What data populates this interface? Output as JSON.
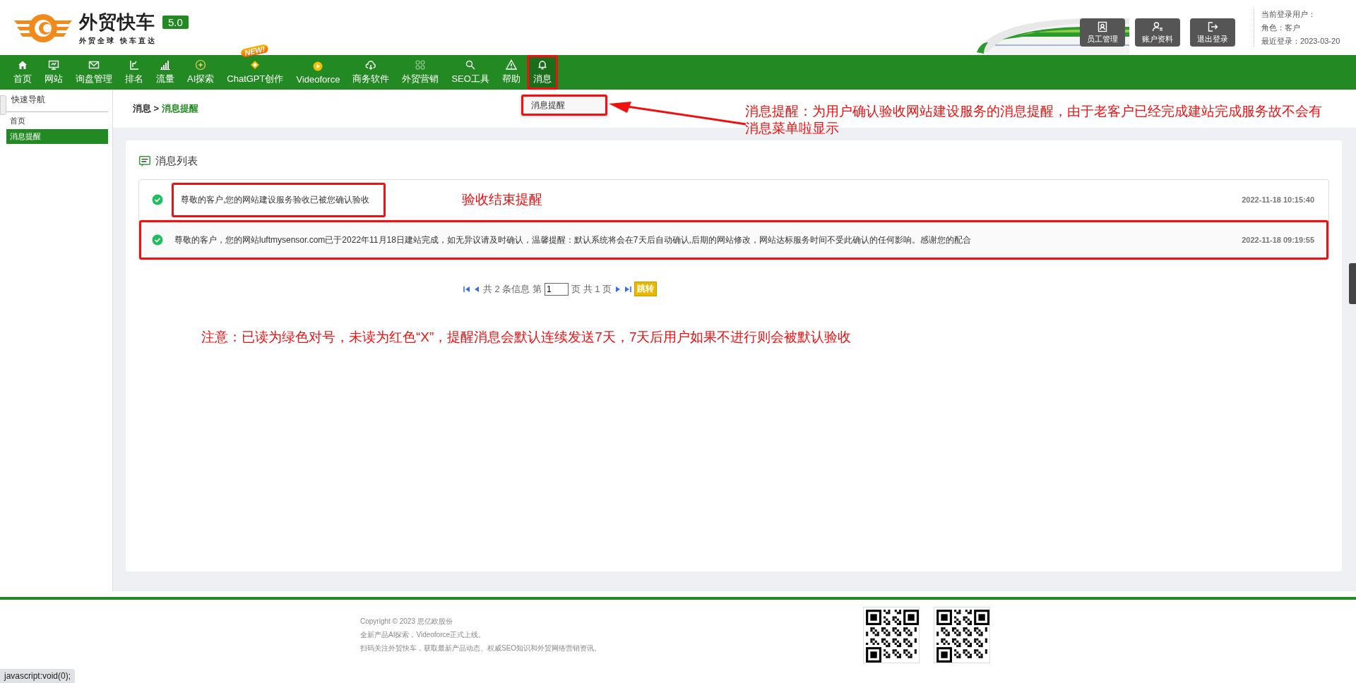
{
  "header": {
    "logo": {
      "title": "外贸快车",
      "version": "5.0",
      "slogan": "外贸全球 快车直达"
    },
    "actions": [
      {
        "label": "员工管理"
      },
      {
        "label": "账户资料"
      },
      {
        "label": "退出登录"
      }
    ],
    "user": {
      "current": "当前登录用户：",
      "role": "角色：客户",
      "last_login": "最近登录：2023-03-20"
    }
  },
  "nav": [
    {
      "label": "首页",
      "selected": false
    },
    {
      "label": "网站",
      "selected": false
    },
    {
      "label": "询盘管理",
      "selected": false
    },
    {
      "label": "排名",
      "selected": false
    },
    {
      "label": "流量",
      "selected": false
    },
    {
      "label": "AI探索",
      "selected": false
    },
    {
      "label": "ChatGPT创作",
      "selected": false,
      "badge": "NEW!"
    },
    {
      "label": "Videoforce",
      "selected": false
    },
    {
      "label": "商务软件",
      "selected": false
    },
    {
      "label": "外贸营销",
      "selected": false
    },
    {
      "label": "SEO工具",
      "selected": false
    },
    {
      "label": "帮助",
      "selected": false
    },
    {
      "label": "消息",
      "selected": true,
      "highlighted": true
    }
  ],
  "dropdown": {
    "highlighted": true,
    "items": [
      "消息提醒"
    ]
  },
  "sidebar": {
    "title": "快速导航",
    "items": [
      {
        "label": "首页",
        "selected": false
      },
      {
        "label": "消息提醒",
        "selected": true
      }
    ]
  },
  "breadcrumb": {
    "parent": "消息 >",
    "current": "消息提醒"
  },
  "panel": {
    "title": "消息列表",
    "messages": [
      {
        "text": "尊敬的客户,您的网站建设服务验收已被您确认验收",
        "time": "2022-11-18 10:15:40",
        "read": true,
        "text_highlighted": true,
        "row_highlighted": false
      },
      {
        "text": "尊敬的客户，您的网站luftmysensor.com已于2022年11月18日建站完成，如无异议请及时确认，温馨提醒：默认系统将会在7天后自动确认,后期的网站修改，网站达标服务时间不受此确认的任何影响。感谢您的配合",
        "time": "2022-11-18 09:19:55",
        "read": true,
        "text_highlighted": false,
        "row_highlighted": true
      }
    ],
    "pagination": {
      "summary": "共 2 条信息 第",
      "page": "1",
      "total": "页 共 1 页",
      "go": "跳转"
    }
  },
  "annotations": [
    {
      "text": "消息提醒：为用户确认验收网站建设服务的消息提醒，由于老客户已经完成建站完成服务故不会有消息菜单啦显示"
    },
    {
      "text": "验收结束提醒"
    },
    {
      "text": "注意：已读为绿色对号，未读为红色“X”，提醒消息会默认连续发送7天，7天后用户如果不进行则会被默认验收"
    }
  ],
  "footer": {
    "lines": [
      "Copyright © 2023 思亿欧股份",
      "全新产品AI探索，Videoforce正式上线。",
      "扫码关注外贸快车，获取最新产品动态、权威SEO知识和外贸网络营销资讯。"
    ]
  },
  "status_bar": "javascript:void(0);"
}
